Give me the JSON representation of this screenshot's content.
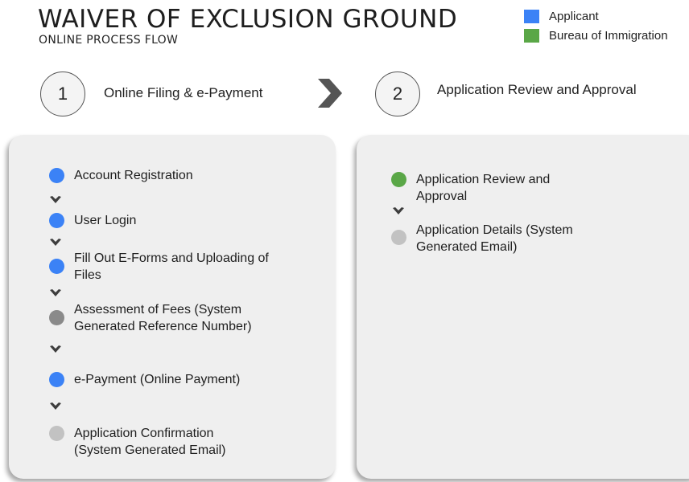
{
  "header": {
    "title": "WAIVER OF EXCLUSION GROUND",
    "subtitle": "ONLINE PROCESS FLOW"
  },
  "legend": [
    {
      "label": "Applicant",
      "color": "#3b82f6"
    },
    {
      "label": "Bureau of Immigration",
      "color": "#5aa747"
    }
  ],
  "steps": [
    {
      "number": "1",
      "label": "Online Filing & e-Payment"
    },
    {
      "number": "2",
      "label": "Application Review and Approval"
    }
  ],
  "colors": {
    "applicant": "#3b82f6",
    "bureau": "#5aa747",
    "system": "#c2c2c2",
    "system_dark": "#8a8a8a",
    "chevron": "#3d3d3d"
  },
  "panel_left": {
    "items": [
      {
        "text": "Account Registration",
        "actor": "applicant"
      },
      {
        "text": "User Login",
        "actor": "applicant"
      },
      {
        "text": "Fill Out E-Forms and Uploading of Files",
        "actor": "applicant"
      },
      {
        "text": "Assessment of Fees (System Generated Reference Number)",
        "actor": "system_dark"
      },
      {
        "text": "e-Payment (Online Payment)",
        "actor": "applicant"
      },
      {
        "text": "Application Confirmation (System Generated Email)",
        "actor": "system"
      }
    ]
  },
  "panel_right": {
    "items": [
      {
        "text": "Application Review and Approval",
        "actor": "bureau"
      },
      {
        "text": "Application Details (System Generated Email)",
        "actor": "system"
      }
    ]
  }
}
